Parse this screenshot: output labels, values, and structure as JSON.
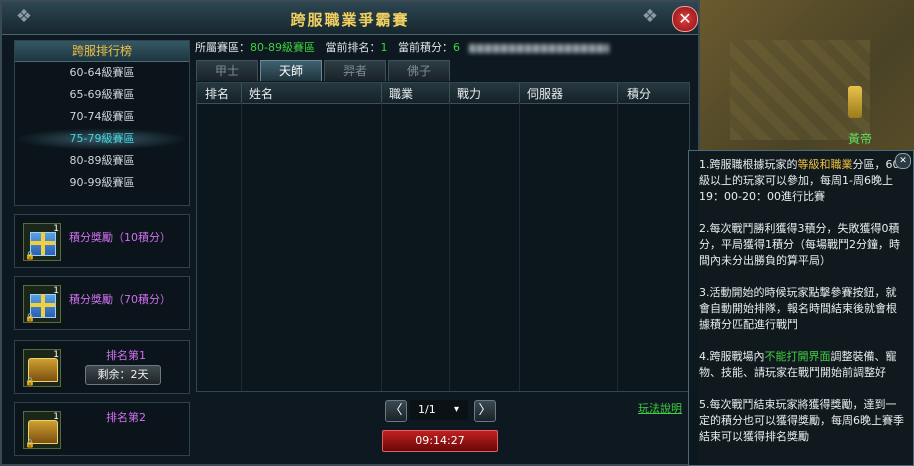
{
  "window": {
    "title": "跨服職業爭霸賽",
    "close": "✕"
  },
  "npc_name": "黃帝",
  "sidebar": {
    "header": "跨服排行榜",
    "items": [
      "60-64級賽區",
      "65-69級賽區",
      "70-74級賽區",
      "75-79級賽區",
      "80-89級賽區",
      "90-99級賽區"
    ],
    "selected_index": 3
  },
  "rewards": [
    {
      "label": "積分獎勵（10積分）",
      "count": "1",
      "icon": "gift-box-icon"
    },
    {
      "label": "積分獎勵（70積分）",
      "count": "1",
      "icon": "gift-box-icon"
    },
    {
      "label": "排名第1",
      "count": "1",
      "icon": "treasure-chest-icon",
      "remaining": "剩余：2天"
    },
    {
      "label": "排名第2",
      "count": "1",
      "icon": "treasure-chest-icon"
    }
  ],
  "info": {
    "zone_label": "所屬賽區：",
    "zone_value": "80-89級賽區",
    "rank_label": "當前排名：",
    "rank_value": "1",
    "score_label": "當前積分：",
    "score_value": "6"
  },
  "tabs": [
    {
      "label": "甲士",
      "active": false
    },
    {
      "label": "天師",
      "active": true
    },
    {
      "label": "羿者",
      "active": false
    },
    {
      "label": "佛子",
      "active": false
    }
  ],
  "table": {
    "columns": [
      "排名",
      "姓名",
      "職業",
      "戰力",
      "伺服器",
      "積分"
    ]
  },
  "pager": {
    "prev": "〈",
    "next": "〉",
    "page": "1/1",
    "dropdown": "▾"
  },
  "rules_link": "玩法說明",
  "timer": "09:14:27",
  "tooltip": {
    "close": "✕",
    "p1_a": "1.跨服職根據玩家的",
    "p1_b": "等級和職業",
    "p1_c": "分區，60級以上的玩家可以參加，每周1-周6晚上19：00-20：00進行比賽",
    "p2": "2.每次戰鬥勝利獲得3積分，失敗獲得0積分，平局獲得1積分（每場戰鬥2分鐘，時間內未分出勝負的算平局）",
    "p3": "3.活動開始的時候玩家點擊參賽按鈕，就會自動開始排隊，報名時間結束後就會根據積分匹配進行戰鬥",
    "p4_a": "4.跨服戰場內",
    "p4_b": "不能打開界面",
    "p4_c": "調整裝備、寵物、技能、請玩家在戰鬥開始前調整好",
    "p5": "5.每次戰鬥結束玩家將獲得獎勵，達到一定的積分也可以獲得獎勵，每周6晚上賽季結束可以獲得排名獎勵"
  },
  "colors": {
    "accent_gold": "#f0c040",
    "highlight_green": "#40d040",
    "selected_cyan": "#40d8d8",
    "reward_purple": "#d070f0",
    "timer_red": "#c02020"
  }
}
